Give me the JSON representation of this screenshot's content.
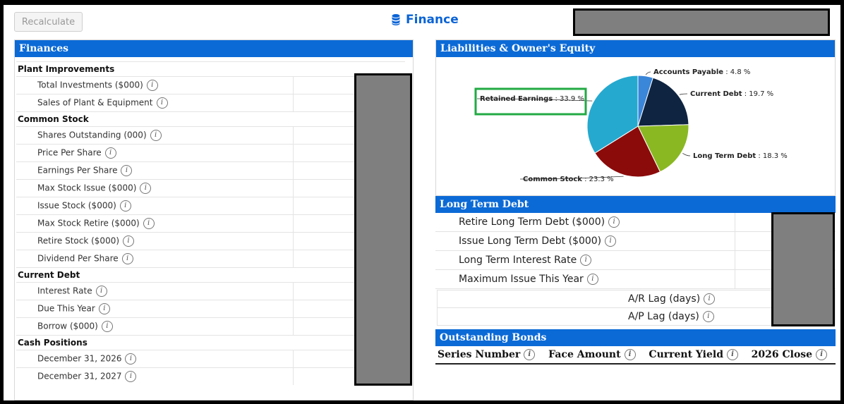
{
  "toolbar": {
    "recalculate_label": "Recalculate"
  },
  "header": {
    "title": "Finance",
    "icon": "database-icon"
  },
  "finances": {
    "title": "Finances",
    "sections": [
      {
        "name": "Plant Improvements",
        "rows": [
          "Total Investments ($000)",
          "Sales of Plant & Equipment"
        ]
      },
      {
        "name": "Common Stock",
        "rows": [
          "Shares Outstanding (000)",
          "Price Per Share",
          "Earnings Per Share",
          "Max Stock Issue ($000)",
          "Issue Stock ($000)",
          "Max Stock Retire ($000)",
          "Retire Stock ($000)",
          "Dividend Per Share"
        ]
      },
      {
        "name": "Current Debt",
        "rows": [
          "Interest Rate",
          "Due This Year",
          "Borrow ($000)"
        ]
      },
      {
        "name": "Cash Positions",
        "rows": [
          "December 31, 2026",
          "December 31, 2027"
        ]
      }
    ]
  },
  "liabilities": {
    "title": "Liabilities & Owner's Equity",
    "chart_data": {
      "type": "pie",
      "slices": [
        {
          "name": "Accounts Payable",
          "value": 4.8,
          "label": "Accounts Payable",
          "pct": ": 4.8 %",
          "color": "#3a86d9"
        },
        {
          "name": "Current Debt",
          "value": 19.7,
          "label": "Current Debt",
          "pct": ": 19.7 %",
          "color": "#0f2440"
        },
        {
          "name": "Long Term Debt",
          "value": 18.3,
          "label": "Long Term Debt",
          "pct": ": 18.3 %",
          "color": "#8ab823"
        },
        {
          "name": "Common Stock",
          "value": 23.3,
          "label": "Common Stock",
          "pct": ": 23.3 %",
          "color": "#8b0b0b"
        },
        {
          "name": "Retained Earnings",
          "value": 33.9,
          "label": "Retained Earnings",
          "pct": ": 33.9 %",
          "color": "#25a9cf"
        }
      ]
    }
  },
  "long_term_debt": {
    "title": "Long Term Debt",
    "rows": [
      "Retire Long Term Debt ($000)",
      "Issue Long Term Debt ($000)",
      "Long Term Interest Rate",
      "Maximum Issue This Year"
    ]
  },
  "lags": {
    "ar": "A/R Lag (days)",
    "ap": "A/P Lag (days)"
  },
  "bonds": {
    "title": "Outstanding Bonds",
    "columns": [
      "Series Number",
      "Face Amount",
      "Current Yield",
      "2026 Close"
    ]
  },
  "info_glyph": "i",
  "colors": {
    "accent": "#0b6ad6",
    "redacted": "#7f7f7f",
    "highlight": "#22aa44"
  }
}
